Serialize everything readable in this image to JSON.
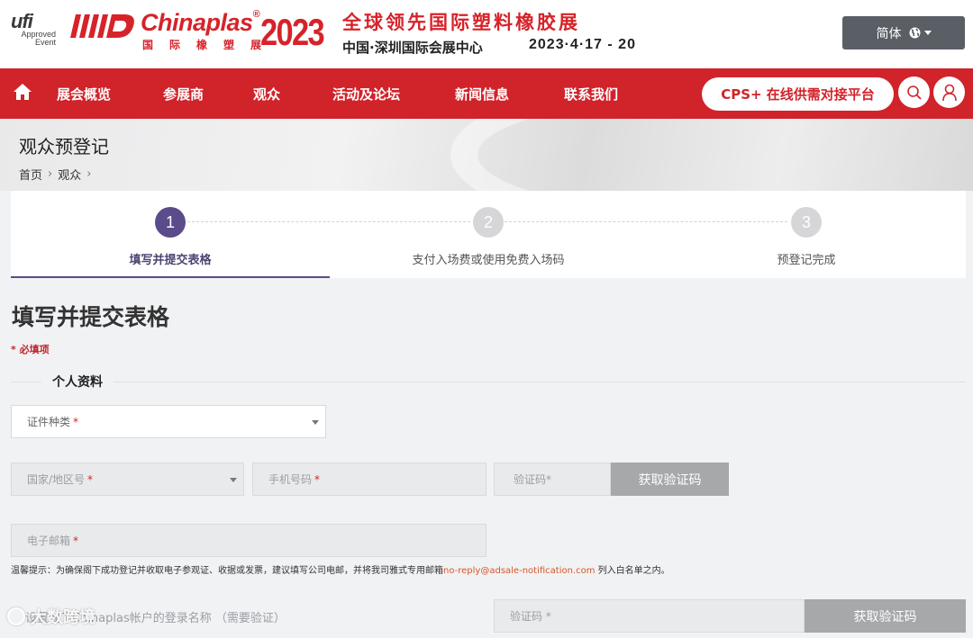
{
  "header": {
    "ufi_logo": "ufi",
    "ufi_sub1": "Approved",
    "ufi_sub2": "Event",
    "brand_name": "Chinaplas",
    "brand_reg": "®",
    "brand_cn": "国际橡塑展",
    "year": "2023",
    "expo_title": "全球领先国际塑料橡胶展",
    "venue": "中国·深圳国际会展中心",
    "date": "2023·4·17 - 20",
    "language_label": "简体"
  },
  "nav": {
    "items": [
      "展会概览",
      "参展商",
      "观众",
      "活动及论坛",
      "新闻信息",
      "联系我们"
    ],
    "cps_label": "CPS+ 在线供需对接平台"
  },
  "banner": {
    "title": "观众预登记",
    "breadcrumb": [
      "首页",
      "观众"
    ]
  },
  "steps": [
    {
      "num": "1",
      "label": "填写并提交表格",
      "active": true
    },
    {
      "num": "2",
      "label": "支付入场费或使用免费入场码",
      "active": false
    },
    {
      "num": "3",
      "label": "预登记完成",
      "active": false
    }
  ],
  "form": {
    "title": "填写并提交表格",
    "required_note": "* 必填项",
    "section_personal": "个人资料",
    "id_type_placeholder": "证件种类",
    "country_code_placeholder": "国家/地区号",
    "mobile_placeholder": "手机号码",
    "sms_code_placeholder": "验证码*",
    "get_code_label": "获取验证码",
    "email_placeholder": "电子邮箱",
    "tip_prefix": "温馨提示：为确保阁下成功登记并收取电子参观证、收据或发票，建议填写公司电邮，并将我司雅式专用邮箱",
    "tip_email": "no-reply@adsale-notification.com",
    "tip_suffix": " 列入白名单之内。",
    "login_label": "设置阁下Chinaplas帐户的登录名称 （需要验证）",
    "login_code_placeholder": "验证码 *",
    "login_get_code_label": "获取验证码",
    "required_star": "*"
  },
  "watermark": "大数跨境",
  "colors": {
    "brand_red": "#d1232a",
    "step_active": "#5b4b8a",
    "step_inactive": "#d6d6d8",
    "link_orange": "#d4572a"
  }
}
